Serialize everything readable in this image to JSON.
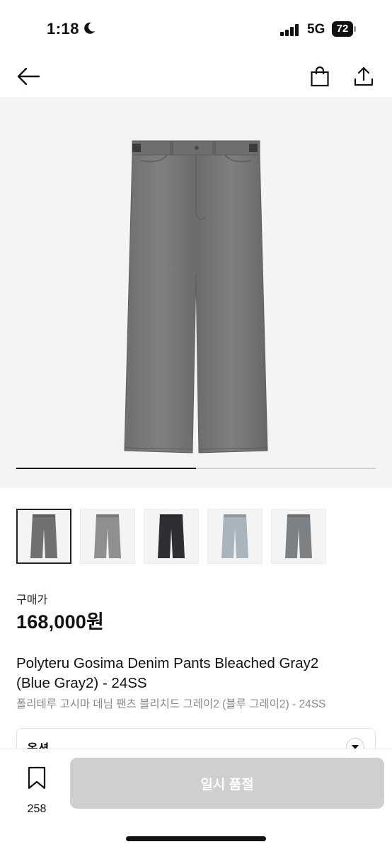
{
  "status_bar": {
    "time": "1:18",
    "network": "5G",
    "battery": "72"
  },
  "nav": {
    "back_icon": "arrow-left-icon",
    "bag_icon": "shopping-bag-icon",
    "share_icon": "share-icon"
  },
  "gallery": {
    "progress": 0.5,
    "thumbnails": [
      {
        "color": "#6f7070",
        "selected": true
      },
      {
        "color": "#8e8f90",
        "selected": false
      },
      {
        "color": "#2d2f32",
        "selected": false
      },
      {
        "color": "#a9b4bc",
        "selected": false
      },
      {
        "color": "#7e8184",
        "selected": false
      }
    ]
  },
  "product": {
    "price_label": "구매가",
    "price": "168,000원",
    "title_en_line1": "Polyteru Gosima Denim Pants Bleached Gray2",
    "title_en_line2": "(Blue Gray2) - 24SS",
    "title_ko": "폴리테루 고시마 데님 팬츠 블리치드 그레이2 (블루 그레이2) - 24SS"
  },
  "option": {
    "label": "옵션"
  },
  "bottom_bar": {
    "bookmark_count": "258",
    "action_label": "일시 품절"
  },
  "colors": {
    "accent": "#111111",
    "disabled_button": "#cfcfcf",
    "background_gray": "#f4f4f4"
  }
}
